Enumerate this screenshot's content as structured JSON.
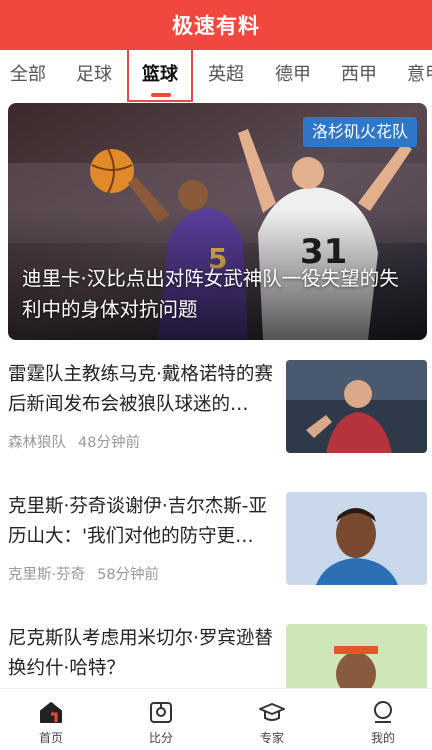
{
  "header": {
    "title": "极速有料"
  },
  "tabs": [
    {
      "label": "全部"
    },
    {
      "label": "足球"
    },
    {
      "label": "篮球",
      "active": true
    },
    {
      "label": "英超"
    },
    {
      "label": "德甲"
    },
    {
      "label": "西甲"
    },
    {
      "label": "意甲"
    }
  ],
  "hero": {
    "tag": "洛杉矶火花队",
    "title": "迪里卡·汉比点出对阵女武神队一役失望的失利中的身体对抗问题"
  },
  "news": [
    {
      "title": "雷霆队主教练马克·戴格诺特的赛后新闻发布会被狼队球迷的…",
      "source": "森林狼队",
      "time": "48分钟前"
    },
    {
      "title": "克里斯·芬奇谈谢伊·吉尔杰斯-亚历山大：'我们对他的防守更…",
      "source": "克里斯·芬奇",
      "time": "58分钟前"
    },
    {
      "title": "尼克斯队考虑用米切尔·罗宾逊替换约什·哈特？",
      "source": "",
      "time": ""
    }
  ],
  "bottom_nav": [
    {
      "label": "首页",
      "icon": "home-icon",
      "active": true
    },
    {
      "label": "比分",
      "icon": "score-icon"
    },
    {
      "label": "专家",
      "icon": "expert-icon"
    },
    {
      "label": "我的",
      "icon": "profile-icon"
    }
  ],
  "colors": {
    "brand": "#f2473f",
    "tag": "#2f78c9"
  }
}
